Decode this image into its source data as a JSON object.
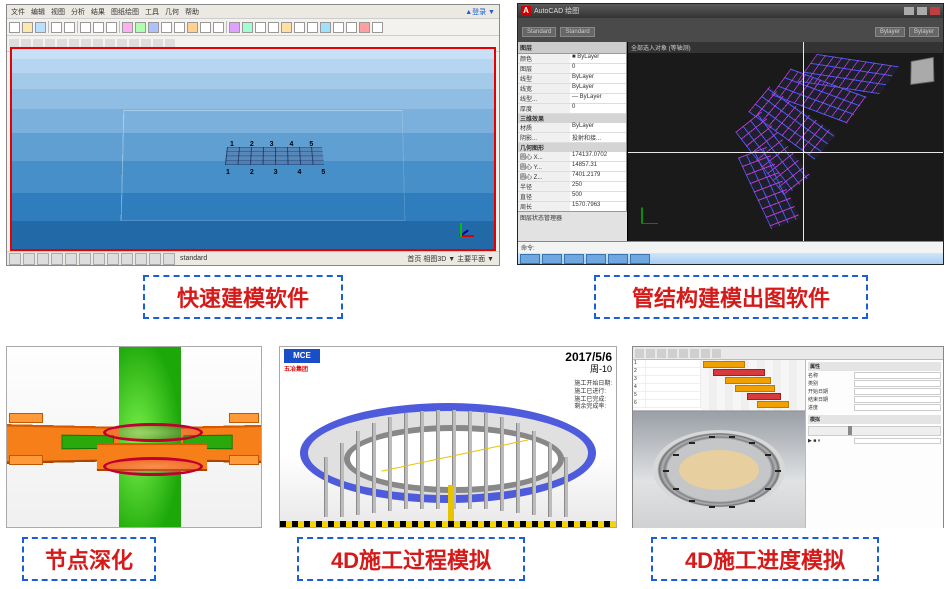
{
  "labels": {
    "panel1": "快速建模软件",
    "panel2": "管结构建模出图软件",
    "panel3": "节点深化",
    "panel4": "4D施工过程模拟",
    "panel5": "4D施工进度模拟"
  },
  "panel1": {
    "menus": [
      "文件",
      "编辑",
      "视图",
      "分析",
      "结果",
      "图纸绘图",
      "工具",
      "几何",
      "帮助"
    ],
    "login": "▲登录 ▼",
    "status_standard": "standard",
    "status_right": "首页  相图3D ▼  主要平面 ▼",
    "grid_top": "1 2 3 4 5",
    "grid_bottom": "1 2 3 4 5"
  },
  "panel2": {
    "app_logo": "A",
    "app_title": "AutoCAD 绘图",
    "ribbon_dd": [
      "Standard",
      "Standard",
      "Bylayer",
      "Bylayer"
    ],
    "tab_title": "全部选入对象 (等轴测)",
    "prop_header": "图层",
    "prop_rows": [
      {
        "k": "颜色",
        "v": "■ ByLayer"
      },
      {
        "k": "图层",
        "v": "0"
      },
      {
        "k": "线型",
        "v": "ByLayer"
      },
      {
        "k": "线宽",
        "v": "ByLayer"
      },
      {
        "k": "线型...",
        "v": "— ByLayer"
      },
      {
        "k": "厚度",
        "v": "0"
      }
    ],
    "sect_3d": "三维效果",
    "prop_rows2": [
      {
        "k": "材质",
        "v": "ByLayer"
      },
      {
        "k": "阴影...",
        "v": "投射和接..."
      }
    ],
    "sect_geom": "几何图形",
    "prop_rows3": [
      {
        "k": "圆心 X...",
        "v": "174137.0702"
      },
      {
        "k": "圆心 Y...",
        "v": "14857.31"
      },
      {
        "k": "圆心 Z...",
        "v": "7401.2179"
      },
      {
        "k": "半径",
        "v": "250"
      },
      {
        "k": "直径",
        "v": "500"
      },
      {
        "k": "周长",
        "v": "1570.7963"
      }
    ],
    "layerbar_text": "图层状态管理器",
    "cmd_prompt": "命令:"
  },
  "panel4": {
    "logo": "MCE",
    "logo_sub": "五冶集团",
    "date": "2017/5/6",
    "day": "周-10",
    "info_lines": [
      "施工开始日期:",
      "施工已进行:",
      "施工已完成:",
      "剩余完成率:"
    ]
  },
  "panel5": {
    "gantt_rows": [
      "1",
      "2",
      "3",
      "4",
      "5",
      "6"
    ],
    "props_header": "属性",
    "fields": [
      {
        "lab": "名称",
        "val": ""
      },
      {
        "lab": "类别",
        "val": ""
      },
      {
        "lab": "开始日期",
        "val": ""
      },
      {
        "lab": "结束日期",
        "val": ""
      },
      {
        "lab": "进度",
        "val": ""
      }
    ],
    "sim_header": "模拟"
  }
}
